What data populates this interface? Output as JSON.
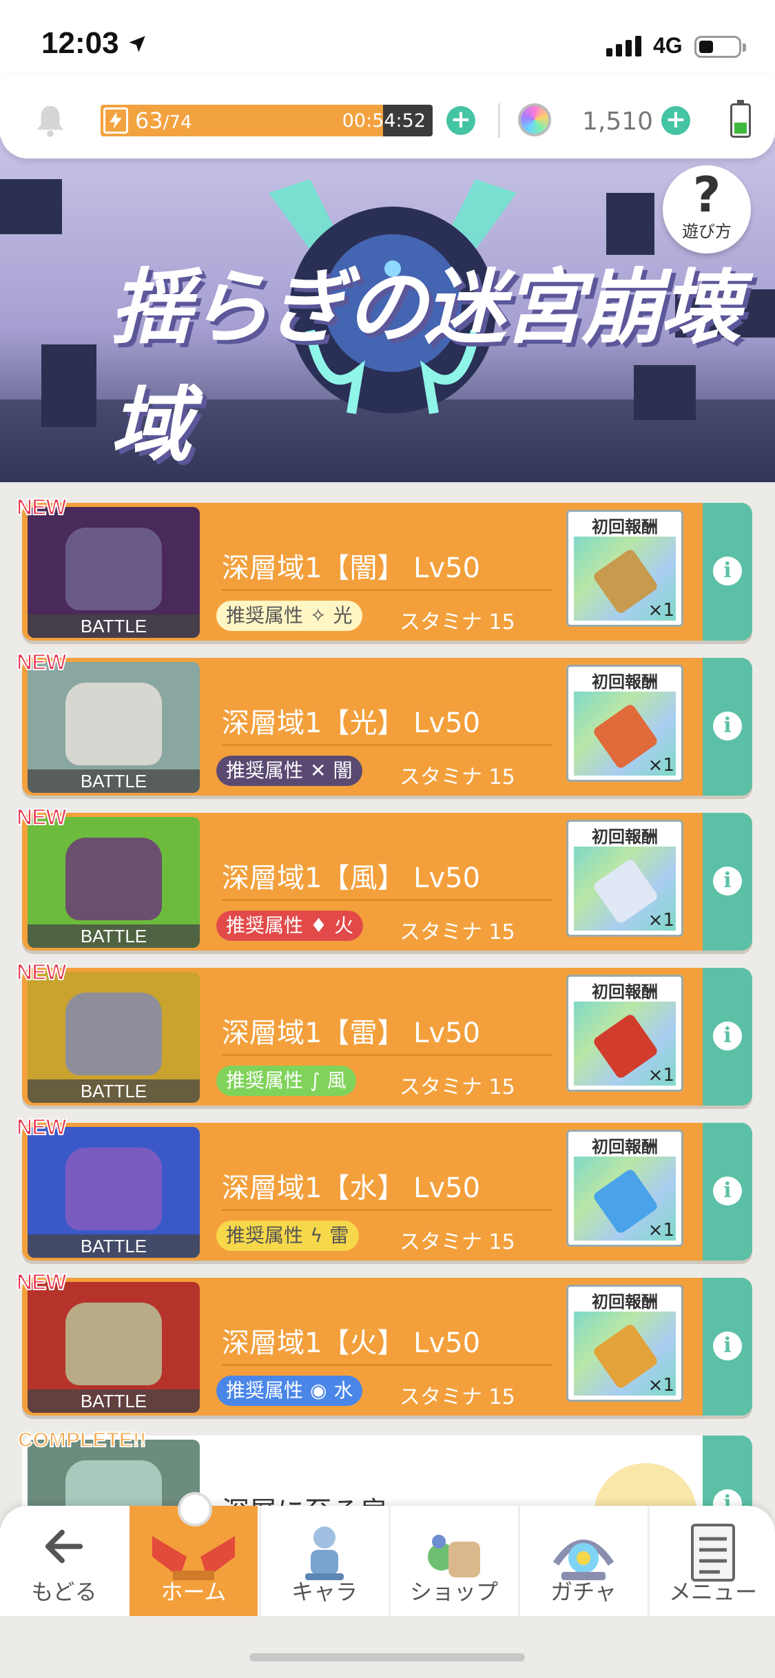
{
  "status": {
    "time": "12:03",
    "network": "4G"
  },
  "resources": {
    "stamina_current": "63",
    "stamina_max": "/74",
    "stamina_fill_fraction": 0.85,
    "stamina_timer": "00:54:52",
    "gems": "1,510"
  },
  "banner": {
    "title": "揺らぎの迷宮崩壊域",
    "howto_symbol": "?",
    "howto_label": "遊び方"
  },
  "quests": [
    {
      "badge": "NEW",
      "thumb_label": "BATTLE",
      "title": "深層域1【闇】 Lv50",
      "attr_label": "推奨属性",
      "attr_icon": "✧",
      "attr": "光",
      "stamina": "スタミナ 15",
      "reward_label": "初回報酬",
      "reward_qty": "×1",
      "attr_color": "#fff6c4",
      "attr_text_color": "#555555"
    },
    {
      "badge": "NEW",
      "thumb_label": "BATTLE",
      "title": "深層域1【光】 Lv50",
      "attr_label": "推奨属性",
      "attr_icon": "✕",
      "attr": "闇",
      "stamina": "スタミナ 15",
      "reward_label": "初回報酬",
      "reward_qty": "×1",
      "attr_color": "#5a4a72",
      "attr_text_color": "#ffffff"
    },
    {
      "badge": "NEW",
      "thumb_label": "BATTLE",
      "title": "深層域1【風】 Lv50",
      "attr_label": "推奨属性",
      "attr_icon": "♦",
      "attr": "火",
      "stamina": "スタミナ 15",
      "reward_label": "初回報酬",
      "reward_qty": "×1",
      "attr_color": "#e24a4a",
      "attr_text_color": "#ffffff"
    },
    {
      "badge": "NEW",
      "thumb_label": "BATTLE",
      "title": "深層域1【雷】 Lv50",
      "attr_label": "推奨属性",
      "attr_icon": "∫",
      "attr": "風",
      "stamina": "スタミナ 15",
      "reward_label": "初回報酬",
      "reward_qty": "×1",
      "attr_color": "#7fd35a",
      "attr_text_color": "#ffffff"
    },
    {
      "badge": "NEW",
      "thumb_label": "BATTLE",
      "title": "深層域1【水】 Lv50",
      "attr_label": "推奨属性",
      "attr_icon": "ϟ",
      "attr": "雷",
      "stamina": "スタミナ 15",
      "reward_label": "初回報酬",
      "reward_qty": "×1",
      "attr_color": "#f6d84a",
      "attr_text_color": "#555555"
    },
    {
      "badge": "NEW",
      "thumb_label": "BATTLE",
      "title": "深層域1【火】 Lv50",
      "attr_label": "推奨属性",
      "attr_icon": "◉",
      "attr": "水",
      "stamina": "スタミナ 15",
      "reward_label": "初回報酬",
      "reward_qty": "×1",
      "attr_color": "#4a86e8",
      "attr_text_color": "#ffffff"
    }
  ],
  "complete_quest": {
    "badge": "COMPLETE!!",
    "title": "深層に至る扉"
  },
  "nav": {
    "back": "もどる",
    "home": "ホーム",
    "chara": "キャラ",
    "shop": "ショップ",
    "gacha": "ガチャ",
    "menu": "メニュー"
  },
  "colors": {
    "accent_orange": "#f3a03c",
    "accent_teal": "#5cc0a6"
  }
}
